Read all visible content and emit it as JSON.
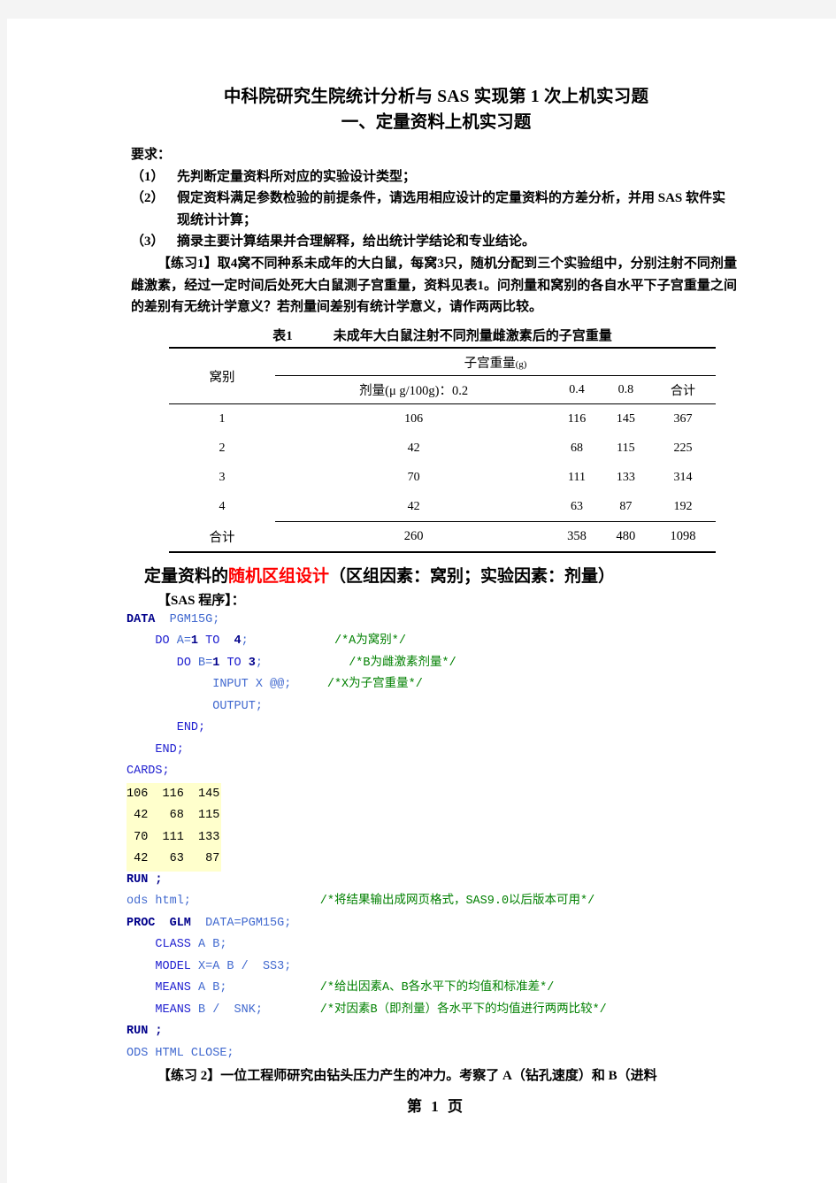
{
  "document": {
    "title_main": "中科院研究生院统计分析与 SAS 实现第 1 次上机实习题",
    "title_sub": "一、定量资料上机实习题",
    "requirements_label": "要求：",
    "requirements": [
      {
        "num": "（1）",
        "text": "先判断定量资料所对应的实验设计类型；"
      },
      {
        "num": "（2）",
        "text": "假定资料满足参数检验的前提条件，请选用相应设计的定量资料的方差分析，并用 SAS 软件实现统计计算；"
      },
      {
        "num": "（3）",
        "text": "摘录主要计算结果并合理解释，给出统计学结论和专业结论。"
      }
    ],
    "exercise1_paragraph": "【练习1】取4窝不同种系未成年的大白鼠，每窝3只，随机分配到三个实验组中，分别注射不同剂量雌激素，经过一定时间后处死大白鼠测子宫重量，资料见表1。问剂量和窝别的各自水平下子宫重量之间的差别有无统计学意义？若剂量间差别有统计学意义，请作两两比较。",
    "exercise2_paragraph": "【练习 2】一位工程师研究由钻头压力产生的冲力。考察了 A（钻孔速度）和 B（进料",
    "footer": "第 1 页"
  },
  "table": {
    "caption_label": "表1",
    "caption_text": "未成年大白鼠注射不同剂量雌激素后的子宫重量",
    "row_header": "窝别",
    "span_header": "子宫重量",
    "span_header_unit": "(g)",
    "dose_header": "剂量(μ g/100g)：0.2",
    "columns": [
      "0.4",
      "0.8",
      "合计"
    ],
    "rows": [
      {
        "label": "1",
        "values": [
          "106",
          "116",
          "145",
          "367"
        ]
      },
      {
        "label": "2",
        "values": [
          "42",
          "68",
          "115",
          "225"
        ]
      },
      {
        "label": "3",
        "values": [
          "70",
          "111",
          "133",
          "314"
        ]
      },
      {
        "label": "4",
        "values": [
          "42",
          "63",
          "87",
          "192"
        ]
      }
    ],
    "total_label": "合计",
    "total_values": [
      "260",
      "358",
      "480",
      "1098"
    ]
  },
  "section": {
    "heading_prefix": "定量资料的",
    "heading_highlight": "随机区组设计",
    "heading_suffix": "（区组因素：窝别；实验因素：剂量）",
    "highlight_color": "#ff0000",
    "sas_label": "【SAS 程序】："
  },
  "code": {
    "lines": [
      {
        "tokens": [
          {
            "t": "DATA",
            "c": "kw"
          },
          {
            "t": "  ",
            "c": "plain"
          },
          {
            "t": "PGM15G;",
            "c": "name"
          }
        ]
      },
      {
        "tokens": [
          {
            "t": "    ",
            "c": "plain"
          },
          {
            "t": "DO",
            "c": "kw2"
          },
          {
            "t": " ",
            "c": "plain"
          },
          {
            "t": "A=",
            "c": "name"
          },
          {
            "t": "1",
            "c": "num"
          },
          {
            "t": " ",
            "c": "plain"
          },
          {
            "t": "TO",
            "c": "kw2"
          },
          {
            "t": "  ",
            "c": "plain"
          },
          {
            "t": "4",
            "c": "num"
          },
          {
            "t": ";",
            "c": "name"
          },
          {
            "t": "            ",
            "c": "plain"
          },
          {
            "t": "/*A为窝别*/",
            "c": "cmt"
          }
        ]
      },
      {
        "tokens": [
          {
            "t": "       ",
            "c": "plain"
          },
          {
            "t": "DO",
            "c": "kw2"
          },
          {
            "t": " ",
            "c": "plain"
          },
          {
            "t": "B=",
            "c": "name"
          },
          {
            "t": "1",
            "c": "num"
          },
          {
            "t": " ",
            "c": "plain"
          },
          {
            "t": "TO",
            "c": "kw2"
          },
          {
            "t": " ",
            "c": "plain"
          },
          {
            "t": "3",
            "c": "num"
          },
          {
            "t": ";",
            "c": "name"
          },
          {
            "t": "            ",
            "c": "plain"
          },
          {
            "t": "/*B为雌激素剂量*/",
            "c": "cmt"
          }
        ]
      },
      {
        "tokens": [
          {
            "t": "            ",
            "c": "plain"
          },
          {
            "t": "INPUT X @@;",
            "c": "name"
          },
          {
            "t": "     ",
            "c": "plain"
          },
          {
            "t": "/*X为子宫重量*/",
            "c": "cmt"
          }
        ]
      },
      {
        "tokens": [
          {
            "t": "            ",
            "c": "plain"
          },
          {
            "t": "OUTPUT;",
            "c": "name"
          }
        ]
      },
      {
        "tokens": [
          {
            "t": "       ",
            "c": "plain"
          },
          {
            "t": "END;",
            "c": "kw2"
          }
        ]
      },
      {
        "tokens": [
          {
            "t": "    ",
            "c": "plain"
          },
          {
            "t": "END;",
            "c": "kw2"
          }
        ]
      },
      {
        "tokens": [
          {
            "t": "CARDS;",
            "c": "kw2"
          }
        ]
      },
      {
        "highlight": true,
        "tokens": [
          {
            "t": "106  116  145",
            "c": "plain"
          }
        ]
      },
      {
        "highlight": true,
        "tokens": [
          {
            "t": " 42   68  115",
            "c": "plain"
          }
        ]
      },
      {
        "highlight": true,
        "tokens": [
          {
            "t": " 70  111  133",
            "c": "plain"
          }
        ]
      },
      {
        "highlight": true,
        "tokens": [
          {
            "t": " 42   63   87",
            "c": "plain"
          }
        ]
      },
      {
        "tokens": [
          {
            "t": "RUN ;",
            "c": "kw"
          }
        ]
      },
      {
        "tokens": [
          {
            "t": "ods html;",
            "c": "name"
          },
          {
            "t": "                  ",
            "c": "plain"
          },
          {
            "t": "/*将结果输出成网页格式，SAS9.0以后版本可用*/",
            "c": "cmt"
          }
        ]
      },
      {
        "tokens": [
          {
            "t": "PROC",
            "c": "kw"
          },
          {
            "t": "  ",
            "c": "plain"
          },
          {
            "t": "GLM",
            "c": "kw"
          },
          {
            "t": "  ",
            "c": "plain"
          },
          {
            "t": "DATA=PGM15G;",
            "c": "name"
          }
        ]
      },
      {
        "tokens": [
          {
            "t": "    ",
            "c": "plain"
          },
          {
            "t": "CLASS",
            "c": "kw2"
          },
          {
            "t": " ",
            "c": "plain"
          },
          {
            "t": "A B;",
            "c": "name"
          }
        ]
      },
      {
        "tokens": [
          {
            "t": "    ",
            "c": "plain"
          },
          {
            "t": "MODEL",
            "c": "kw2"
          },
          {
            "t": " ",
            "c": "plain"
          },
          {
            "t": "X=A B /  SS3;",
            "c": "name"
          }
        ]
      },
      {
        "tokens": [
          {
            "t": "    ",
            "c": "plain"
          },
          {
            "t": "MEANS",
            "c": "kw2"
          },
          {
            "t": " ",
            "c": "plain"
          },
          {
            "t": "A B;",
            "c": "name"
          },
          {
            "t": "             ",
            "c": "plain"
          },
          {
            "t": "/*给出因素A、B各水平下的均值和标准差*/",
            "c": "cmt"
          }
        ]
      },
      {
        "tokens": [
          {
            "t": "    ",
            "c": "plain"
          },
          {
            "t": "MEANS",
            "c": "kw2"
          },
          {
            "t": " ",
            "c": "plain"
          },
          {
            "t": "B /  SNK;",
            "c": "name"
          },
          {
            "t": "        ",
            "c": "plain"
          },
          {
            "t": "/*对因素B（即剂量）各水平下的均值进行两两比较*/",
            "c": "cmt"
          }
        ]
      },
      {
        "tokens": [
          {
            "t": "RUN ;",
            "c": "kw"
          }
        ]
      },
      {
        "tokens": [
          {
            "t": "ODS HTML CLOSE;",
            "c": "name"
          }
        ]
      }
    ]
  }
}
